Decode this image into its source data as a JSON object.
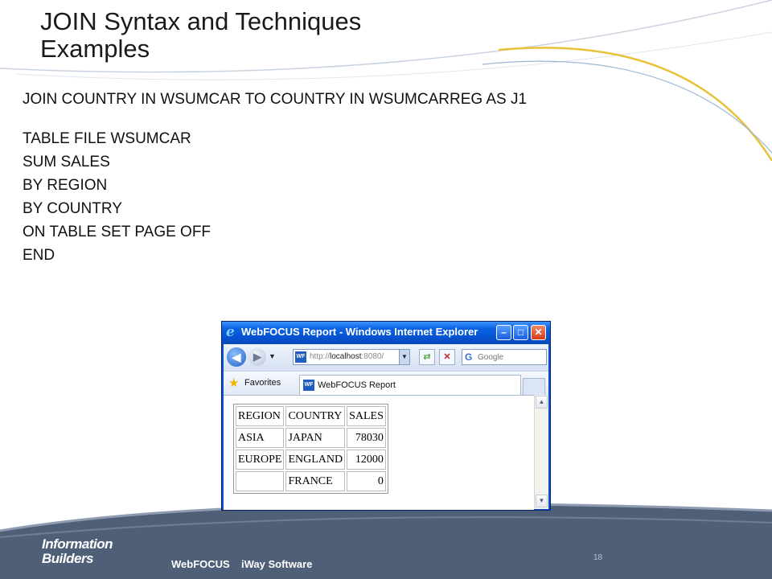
{
  "slide": {
    "title_line1": "JOIN Syntax and Techniques",
    "title_line2": "Examples",
    "join_statement": "JOIN COUNTRY IN WSUMCAR TO COUNTRY IN WSUMCARREG AS J1",
    "code_lines": [
      "TABLE FILE WSUMCAR",
      "SUM SALES",
      "BY REGION",
      "BY COUNTRY",
      "ON TABLE SET PAGE OFF",
      "END"
    ]
  },
  "browser": {
    "window_title": "WebFOCUS Report - Windows Internet Explorer",
    "address_prefix": "http://",
    "address_host": "localhost",
    "address_suffix": ":8080/",
    "search_placeholder": "Google",
    "favorites_label": "Favorites",
    "tab_label": "WebFOCUS Report",
    "wf_icon_text": "WF"
  },
  "report": {
    "headers": [
      "REGION",
      "COUNTRY",
      "SALES"
    ],
    "rows": [
      [
        "ASIA",
        "JAPAN",
        "78030"
      ],
      [
        "EUROPE",
        "ENGLAND",
        "12000"
      ],
      [
        "",
        "FRANCE",
        "0"
      ]
    ]
  },
  "footer": {
    "logo_line1": "Information",
    "logo_line2": "Builders",
    "brand1": "WebFOCUS",
    "brand2": "iWay Software",
    "page_number": "18"
  },
  "colors": {
    "accent_curve": "#e8c23a",
    "footer_dark": "#4f5f78",
    "ie_titlebar": "#0b63e2"
  }
}
